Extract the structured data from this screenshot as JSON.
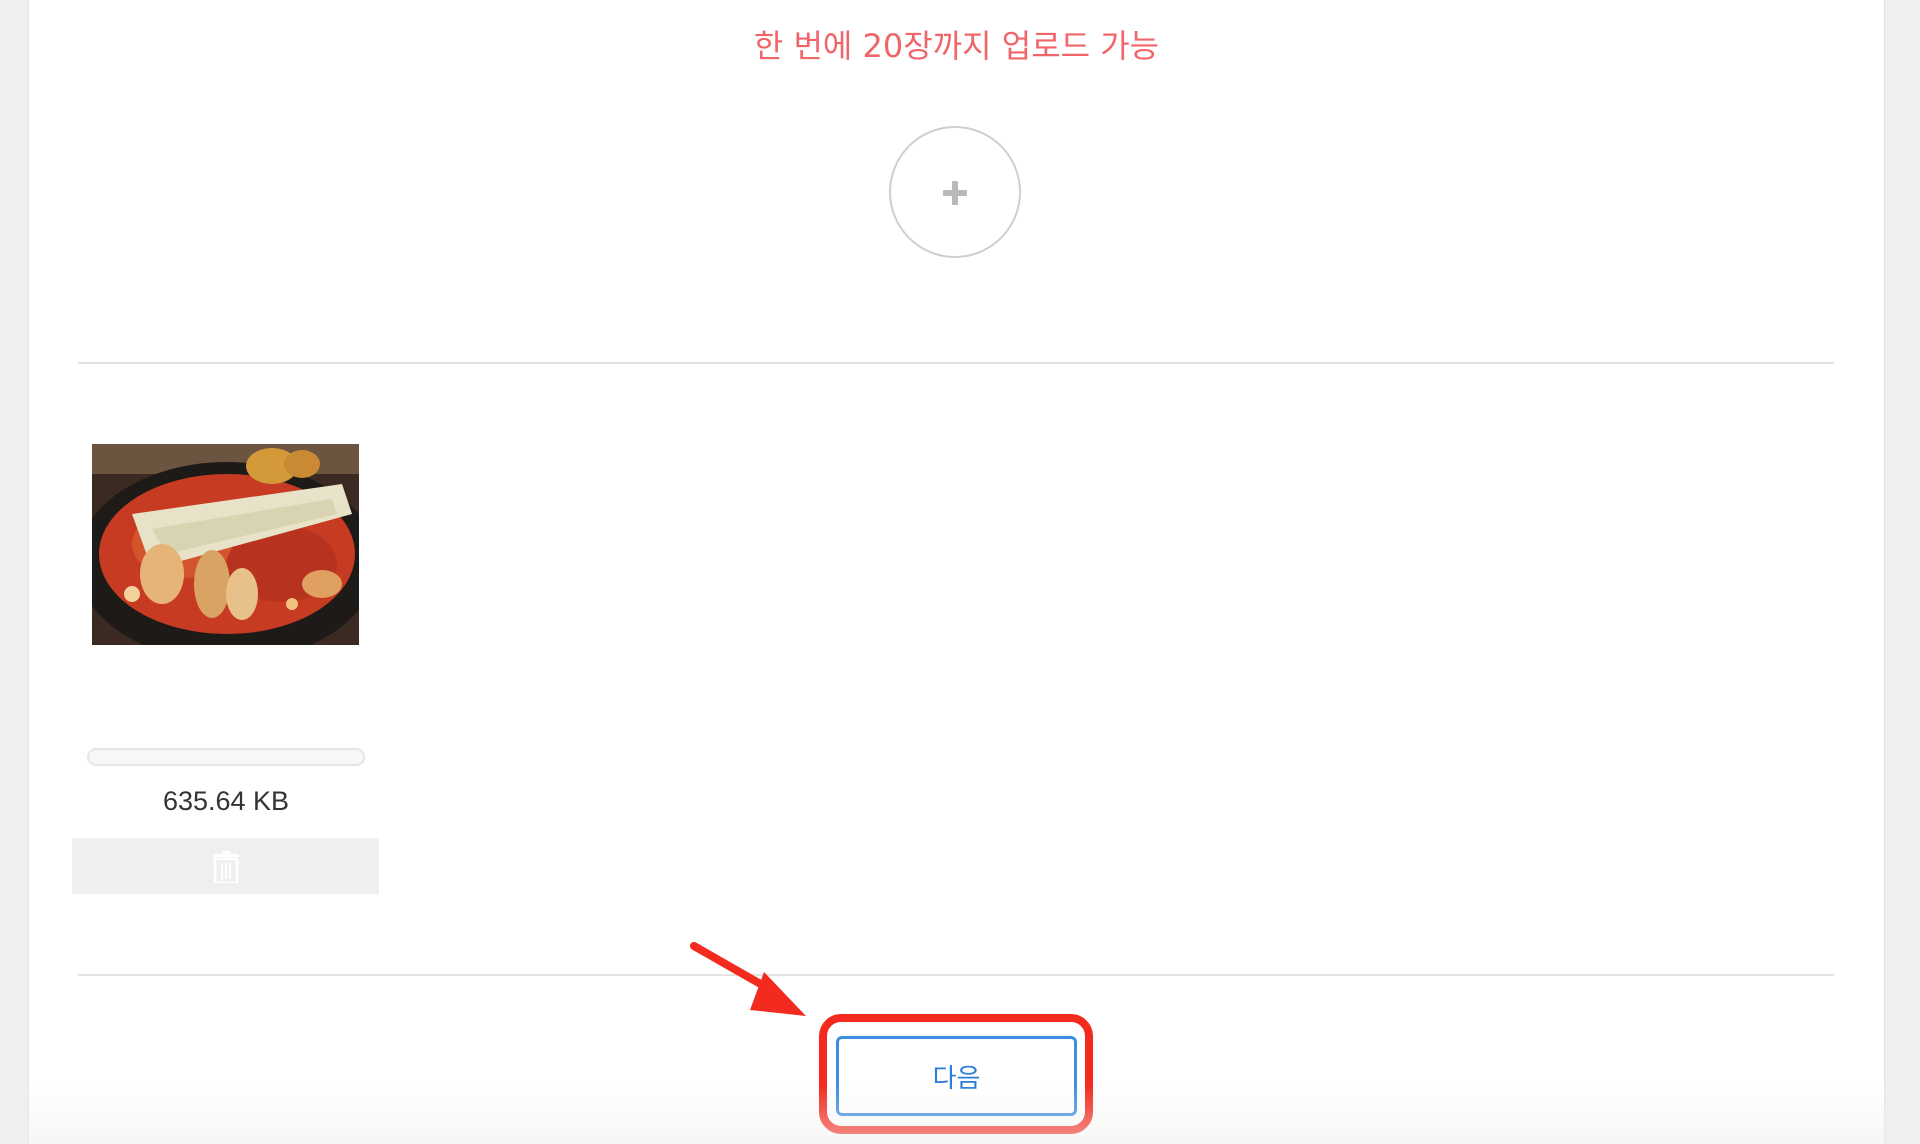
{
  "upload": {
    "notice": "한 번에 20장까지 업로드 가능",
    "add_icon": "plus-icon"
  },
  "file": {
    "thumbnail_subject": "food-photo",
    "size": "635.64 KB",
    "progress_fraction": 0,
    "delete_icon": "trash-icon"
  },
  "footer": {
    "next_label": "다음"
  },
  "colors": {
    "notice": "#f0656a",
    "button_border": "#3b8fdf",
    "annotation_red": "#f32a1e"
  }
}
